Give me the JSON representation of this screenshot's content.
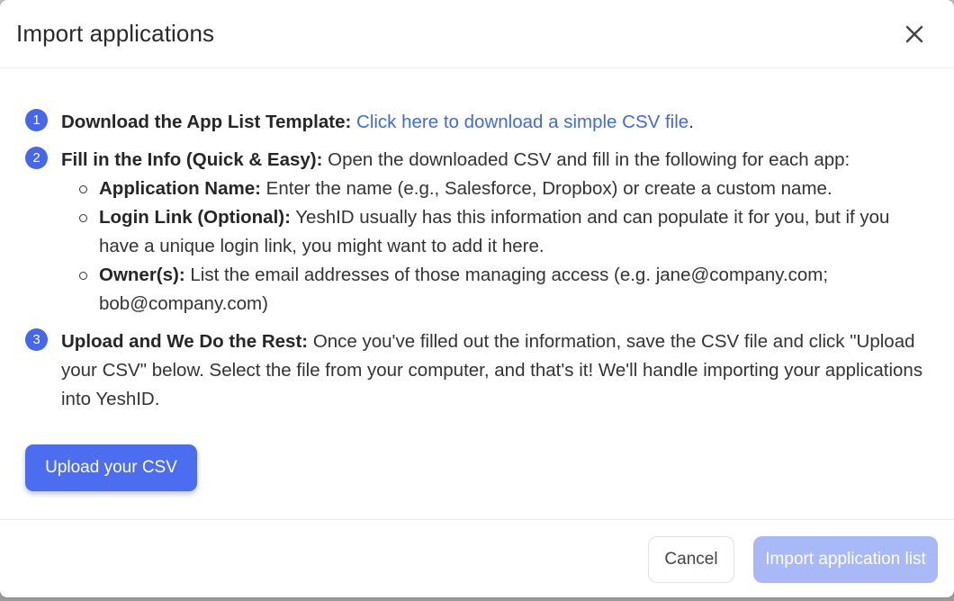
{
  "dialog": {
    "title": "Import applications",
    "close_icon": "close-icon"
  },
  "steps": [
    {
      "number": "1",
      "heading": "Download the App List Template:",
      "link_text": "Click here to download a simple CSV file",
      "trailing": "."
    },
    {
      "number": "2",
      "heading": "Fill in the Info (Quick & Easy):",
      "text": "Open the downloaded CSV and fill in the following for each app:",
      "items": [
        {
          "label": "Application Name:",
          "text": "Enter the name (e.g., Salesforce, Dropbox) or create a custom name."
        },
        {
          "label": "Login Link (Optional):",
          "text": "YeshID usually has this information and can populate it for you, but if you have a unique login link, you might want to add it here."
        },
        {
          "label": "Owner(s):",
          "text": "List the email addresses of those managing access (e.g. jane@company.com; bob@company.com)"
        }
      ]
    },
    {
      "number": "3",
      "heading": "Upload and We Do the Rest:",
      "text": "Once you've filled out the information, save the CSV file and click \"Upload your CSV\" below. Select the file from your computer, and that's it! We'll handle importing your applications into YeshID."
    }
  ],
  "upload_button": "Upload your CSV",
  "footer": {
    "cancel_label": "Cancel",
    "import_label": "Import application list"
  },
  "colors": {
    "accent": "#4c6df0",
    "link": "#3f6ae0",
    "disabled_primary": "#a9b9f7"
  }
}
